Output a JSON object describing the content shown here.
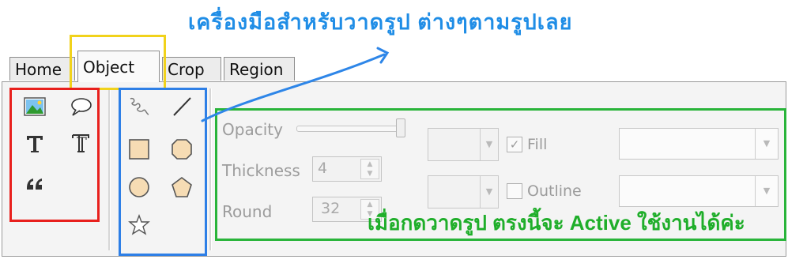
{
  "annotation": {
    "top_note": "เครื่องมือสำหรับวาดรูป ต่างๆตามรูปเลย",
    "bottom_note": "เมื่อกดวาดรูป ตรงนี้จะ Active ใช้งานได้ค่ะ"
  },
  "tabs": [
    {
      "label": "Home"
    },
    {
      "label": "Object"
    },
    {
      "label": "Crop"
    },
    {
      "label": "Region"
    }
  ],
  "properties": {
    "opacity_label": "Opacity",
    "thickness_label": "Thickness",
    "thickness_value": "4",
    "round_label": "Round",
    "round_value": "32",
    "fill_label": "Fill",
    "fill_checked": true,
    "outline_label": "Outline",
    "outline_checked": false,
    "opacity_level": 1.0
  },
  "tools": {
    "group1": [
      "image-icon",
      "speech-bubble-icon",
      "text-icon",
      "text-outline-icon",
      "quote-icon"
    ],
    "group2": [
      "freehand-icon",
      "line-icon",
      "rectangle-icon",
      "octagon-icon",
      "ellipse-icon",
      "pentagon-icon",
      "star-icon"
    ]
  },
  "colors": {
    "top_note": "#1f8de6",
    "bottom_note": "#1fae2a",
    "highlight_tab": "#f1d21b",
    "highlight_tools": "#e8201d",
    "highlight_shapes": "#2e7fe6",
    "highlight_properties": "#29b43a"
  }
}
